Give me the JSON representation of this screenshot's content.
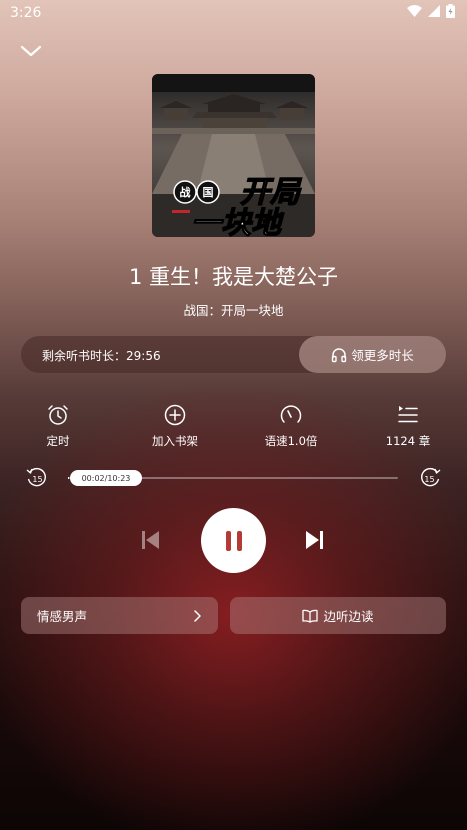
{
  "status_bar": {
    "time": "3:26"
  },
  "cover": {
    "tag1": "战",
    "tag2": "国",
    "title_line1": "开局",
    "title_line2": "一块地"
  },
  "chapter_title": "1 重生！我是大楚公子",
  "book_name": "战国：开局一块地",
  "listen_time": {
    "label": "剩余听书时长：29:56",
    "more_button": "领更多时长"
  },
  "tools": [
    {
      "label": "定时",
      "icon": "alarm-clock-icon"
    },
    {
      "label": "加入书架",
      "icon": "plus-circle-icon"
    },
    {
      "label": "语速1.0倍",
      "icon": "speed-gauge-icon"
    },
    {
      "label": "1124 章",
      "icon": "chapter-list-icon"
    }
  ],
  "progress": {
    "current": "00:02",
    "total": "10:23",
    "display": "00:02/10:23",
    "fraction": 0.003
  },
  "skip": {
    "back_seconds": "15",
    "forward_seconds": "15"
  },
  "voice": {
    "label": "情感男声"
  },
  "read_along": {
    "label": "边听边读"
  }
}
